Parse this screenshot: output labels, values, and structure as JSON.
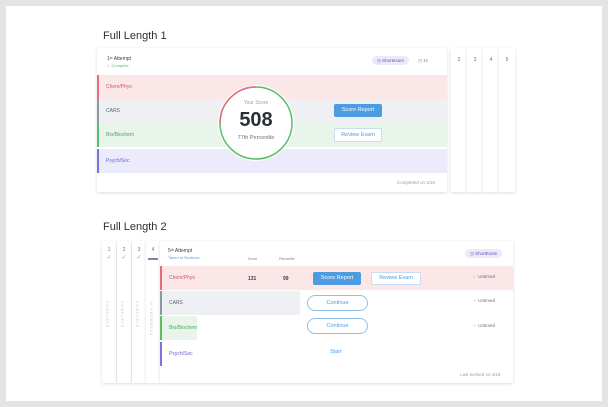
{
  "fl1": {
    "title": "Full Length 1",
    "attempt": "1ˢᵗ Attempt",
    "status": "✓ Complete",
    "pill": "◷ Shortexam",
    "time": "◷ 1s",
    "side_tabs": [
      "2",
      "3",
      "4",
      "5"
    ],
    "rows": [
      "Chem/Phys",
      "CARS",
      "Bio/Biochem",
      "Psych/Soc"
    ],
    "score_label": "Your Score",
    "score_value": "508",
    "percentile": "77th Percentile",
    "btn_score_report": "Score Report",
    "btn_review_exam": "Review Exam",
    "completed": "Completed on 3/18"
  },
  "fl2": {
    "title": "Full Length 2",
    "left_tabs": [
      {
        "num": "1",
        "check": "✓",
        "label": "COMPLETE"
      },
      {
        "num": "2",
        "check": "✓",
        "label": "COMPLETE"
      },
      {
        "num": "3",
        "check": "✓",
        "label": "COMPLETE"
      },
      {
        "num": "4",
        "check": "",
        "label": "IN PROGRESS"
      }
    ],
    "attempt": "5ᵗʰ Attempt",
    "status": "Taken in Sections",
    "col_score": "Score",
    "col_percentile": "Percentile",
    "pill": "◷ ShortExam",
    "rows": [
      "Chem/Phys",
      "CARS",
      "Bio/Biochem",
      "Psych/Soc"
    ],
    "chem_score": "131",
    "chem_percentile": "99",
    "btn_score_report": "Score Report",
    "btn_review_exam": "Review Exam",
    "btn_continue_1": "Continue",
    "btn_continue_2": "Continue",
    "btn_start": "Start",
    "unlead_1": "Untimed",
    "unlead_2": "Untimed",
    "unlead_3": "Untimed",
    "last_worked": "Last worked on 4/18"
  },
  "colors": {
    "chem": "#fbe6e8",
    "cars": "#eef0f3",
    "bio": "#e9f5ea",
    "psych": "#ecebfb",
    "accent": "#4d9be0"
  }
}
